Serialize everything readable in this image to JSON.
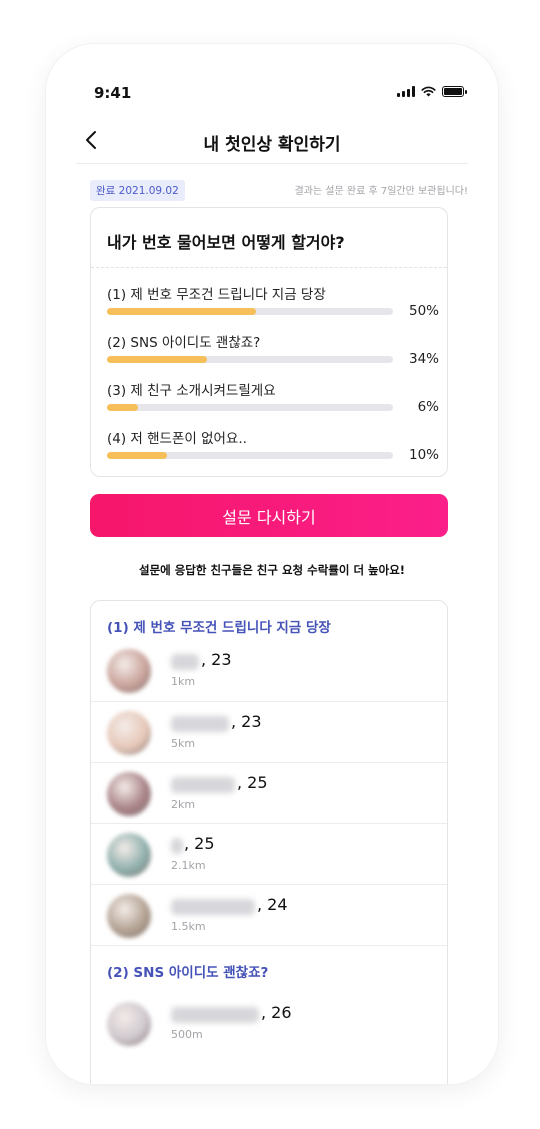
{
  "status_bar": {
    "time": "9:41"
  },
  "header": {
    "title": "내 첫인상 확인하기",
    "back_icon": "chevron-left-icon"
  },
  "info": {
    "completed_badge": "완료 2021.09.02",
    "retention_note": "결과는 설문 완료 후 7일간만 보관됩니다!"
  },
  "survey": {
    "question": "내가 번호 물어보면 어떻게 할거야?",
    "options": [
      {
        "label": "(1) 제 번호 무조건 드립니다 지금 당장",
        "percent_text": "50%",
        "fill_percent": 52
      },
      {
        "label": "(2) SNS 아이디도 괜찮죠?",
        "percent_text": "34%",
        "fill_percent": 35
      },
      {
        "label": "(3) 제 친구 소개시켜드릴게요",
        "percent_text": "6%",
        "fill_percent": 11
      },
      {
        "label": "(4) 저 핸드폰이 없어요..",
        "percent_text": "10%",
        "fill_percent": 21
      }
    ],
    "bar_color": "#f7bf59"
  },
  "cta": {
    "retry_label": "설문 다시하기",
    "color_start": "#f6166a",
    "color_end": "#fb1f8a"
  },
  "notice": "설문에 응답한 친구들은 친구 요청 수락률이 더 높아요!",
  "friends": {
    "groups": [
      {
        "title": "(1) 제 번호 무조건 드립니다 지금 당장",
        "people": [
          {
            "age": ", 23",
            "distance": "1km",
            "avatar_color": "#c9a39b"
          },
          {
            "age": ", 23",
            "distance": "5km",
            "avatar_color": "#e6c8b9"
          },
          {
            "age": ", 25",
            "distance": "2km",
            "avatar_color": "#a98388"
          },
          {
            "age": ", 25",
            "distance": "2.1km",
            "avatar_color": "#8fb0ad"
          },
          {
            "age": ", 24",
            "distance": "1.5km",
            "avatar_color": "#b3a293"
          }
        ]
      },
      {
        "title": "(2) SNS 아이디도 괜찮죠?",
        "people": [
          {
            "age": ", 26",
            "distance": "500m",
            "avatar_color": "#cfc8ce"
          }
        ]
      }
    ],
    "title_color": "#4553b8"
  }
}
